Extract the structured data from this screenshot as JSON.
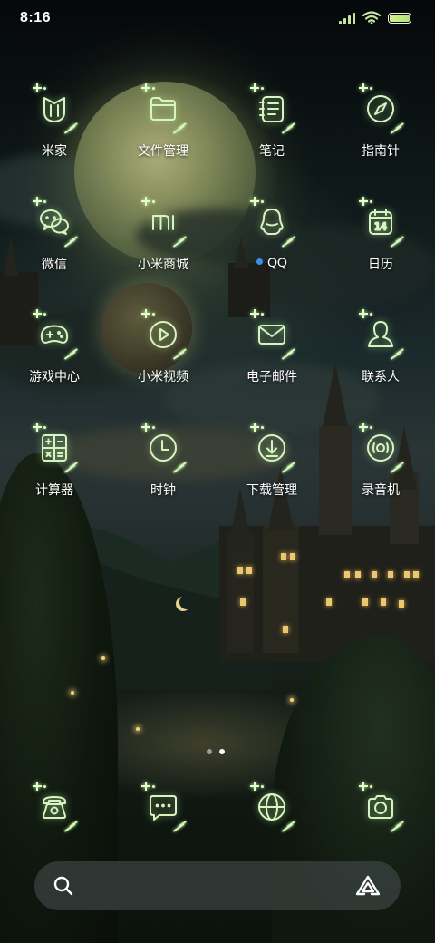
{
  "status_bar": {
    "time": "8:16",
    "icons": [
      "cellular-signal-icon",
      "wifi-icon",
      "battery-icon"
    ],
    "battery_color": "#c6e87e"
  },
  "apps": [
    {
      "label": "米家",
      "icon": "mijia-icon"
    },
    {
      "label": "文件管理",
      "icon": "folder-icon"
    },
    {
      "label": "笔记",
      "icon": "notes-icon"
    },
    {
      "label": "指南针",
      "icon": "compass-icon"
    },
    {
      "label": "微信",
      "icon": "wechat-icon"
    },
    {
      "label": "小米商城",
      "icon": "mi-store-icon"
    },
    {
      "label": "QQ",
      "icon": "qq-penguin-icon",
      "notification_dot": true
    },
    {
      "label": "日历",
      "icon": "calendar-icon",
      "calendar_day": "14"
    },
    {
      "label": "游戏中心",
      "icon": "gamepad-icon"
    },
    {
      "label": "小米视频",
      "icon": "play-icon"
    },
    {
      "label": "电子邮件",
      "icon": "envelope-icon"
    },
    {
      "label": "联系人",
      "icon": "contact-person-icon"
    },
    {
      "label": "计算器",
      "icon": "calculator-icon"
    },
    {
      "label": "时钟",
      "icon": "clock-icon"
    },
    {
      "label": "下载管理",
      "icon": "download-icon"
    },
    {
      "label": "录音机",
      "icon": "recorder-icon"
    }
  ],
  "pager": {
    "pages": 2,
    "current": 2
  },
  "dock": [
    {
      "name": "phone",
      "icon": "phone-icon"
    },
    {
      "name": "messages",
      "icon": "message-icon"
    },
    {
      "name": "browser",
      "icon": "globe-icon"
    },
    {
      "name": "camera",
      "icon": "camera-icon"
    }
  ],
  "search": {
    "left_icon": "search-icon",
    "right_icon": "assistant-triangle-icon"
  },
  "colors": {
    "icon_stroke": "#d8f4c4",
    "notification_dot": "#3b8ee6",
    "label": "#ffffff"
  }
}
